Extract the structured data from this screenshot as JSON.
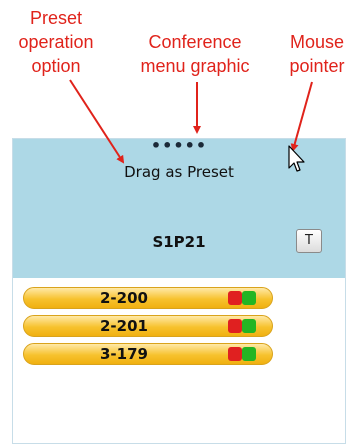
{
  "annotations": {
    "preset": [
      "Preset",
      "operation",
      "option"
    ],
    "conference": [
      "Conference",
      "menu graphic"
    ],
    "mouse": [
      "Mouse",
      "pointer"
    ]
  },
  "panel": {
    "menu_dots": "•••••",
    "drag_label": "Drag as Preset",
    "conference_name": "S1P21",
    "t_button_label": "T",
    "participants": [
      {
        "name": "2-200"
      },
      {
        "name": "2-201"
      },
      {
        "name": "3-179"
      }
    ]
  },
  "colors": {
    "annotation": "#e0231b",
    "header_bg": "#add8e6",
    "participant_bar": "#f7c22e",
    "status_red": "#e02020",
    "status_green": "#23b523"
  },
  "icons": {
    "mouse_pointer": "mouse-pointer-icon",
    "status_red": "status-red-icon",
    "status_green": "status-green-icon"
  }
}
